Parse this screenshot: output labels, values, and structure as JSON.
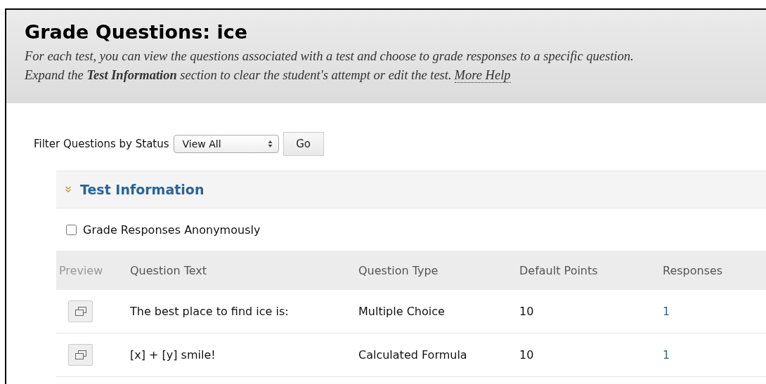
{
  "header": {
    "title": "Grade Questions: ice",
    "description_lines": [
      "For each test, you can view the questions associated with a test and choose to grade responses to a specific question.",
      "Expand the **Test Information** section to clear the student's attempt or edit the test."
    ],
    "help_link": "More Help"
  },
  "filter": {
    "label": "Filter Questions by Status",
    "select_value": "View All",
    "go_button": "Go"
  },
  "test_information": {
    "label": "Test Information",
    "expanded": true
  },
  "anonymous": {
    "label": "Grade Responses Anonymously",
    "checked": false
  },
  "table": {
    "columns": [
      "Preview",
      "Question Text",
      "Question Type",
      "Default Points",
      "Responses"
    ],
    "rows": [
      {
        "question_text": "The best place to find ice is:",
        "question_type": "Multiple Choice",
        "default_points": "10",
        "responses": "1"
      },
      {
        "question_text": "[x] + [y] smile!",
        "question_type": "Calculated Formula",
        "default_points": "10",
        "responses": "1"
      }
    ]
  }
}
